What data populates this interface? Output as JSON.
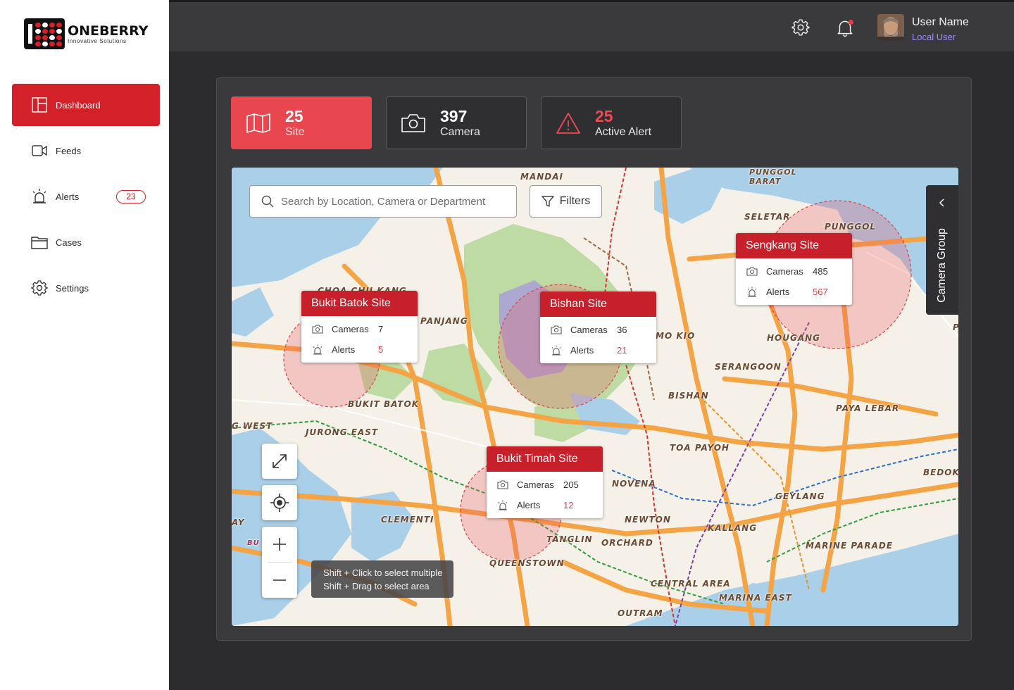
{
  "brand": {
    "name": "ONEBERRY",
    "tagline": "Innovative Solutions"
  },
  "sidebar": {
    "items": [
      {
        "label": "Dashboard",
        "icon": "dashboard-icon",
        "active": true
      },
      {
        "label": "Feeds",
        "icon": "video-camera-icon"
      },
      {
        "label": "Alerts",
        "icon": "alarm-icon",
        "badge": "23"
      },
      {
        "label": "Cases",
        "icon": "folder-icon"
      },
      {
        "label": "Settings",
        "icon": "gear-icon"
      }
    ]
  },
  "header": {
    "settings_icon": "gear-icon",
    "notification_icon": "bell-icon",
    "user": {
      "name": "User Name",
      "role": "Local User"
    }
  },
  "stats": [
    {
      "value": "25",
      "label": "Site",
      "icon": "map-icon"
    },
    {
      "value": "397",
      "label": "Camera",
      "icon": "camera-icon"
    },
    {
      "value": "25",
      "label": "Active Alert",
      "icon": "warning-icon"
    }
  ],
  "map": {
    "search_placeholder": "Search by Location, Camera or Department",
    "filters_label": "Filters",
    "camera_group_label": "Camera Group",
    "hint_line1": "Shift + Click to select multiple",
    "hint_line2": "Shift + Drag to select area",
    "row_labels": {
      "cameras": "Cameras",
      "alerts": "Alerts"
    },
    "sites": [
      {
        "name": "Bukit Batok Site",
        "cameras": "7",
        "alerts": "5"
      },
      {
        "name": "Bishan Site",
        "cameras": "36",
        "alerts": "21"
      },
      {
        "name": "Sengkang Site",
        "cameras": "485",
        "alerts": "567"
      },
      {
        "name": "Bukit Timah Site",
        "cameras": "205",
        "alerts": "12"
      }
    ],
    "places": [
      "MANDAI",
      "PUNGGOL BARAT",
      "SELETAR",
      "PUNGGOL",
      "CHOA CHU KANG",
      "PANJANG",
      "MO KIO",
      "HOUGANG",
      "SERANGOON",
      "BISHAN",
      "BUKIT BATOK",
      "G WEST",
      "JURONG EAST",
      "PAYA LEBAR",
      "TOA PAYOH",
      "BEDOK",
      "NOVENA",
      "GEYLANG",
      "CLEMENTI",
      "NEWTON",
      "KALLANG",
      "AY",
      "TANGLIN",
      "ORCHARD",
      "MARINE PARADE",
      "QUEENSTOWN",
      "CENTRAL AREA",
      "MARINA EAST",
      "OUTRAM",
      "PUNGGOL",
      "BU",
      "G",
      "P"
    ],
    "colors": {
      "brand_red": "#c8202a",
      "road": "#f5a445",
      "water": "#aacfe9",
      "park": "#bddba3",
      "land": "#f5f1e8"
    }
  }
}
